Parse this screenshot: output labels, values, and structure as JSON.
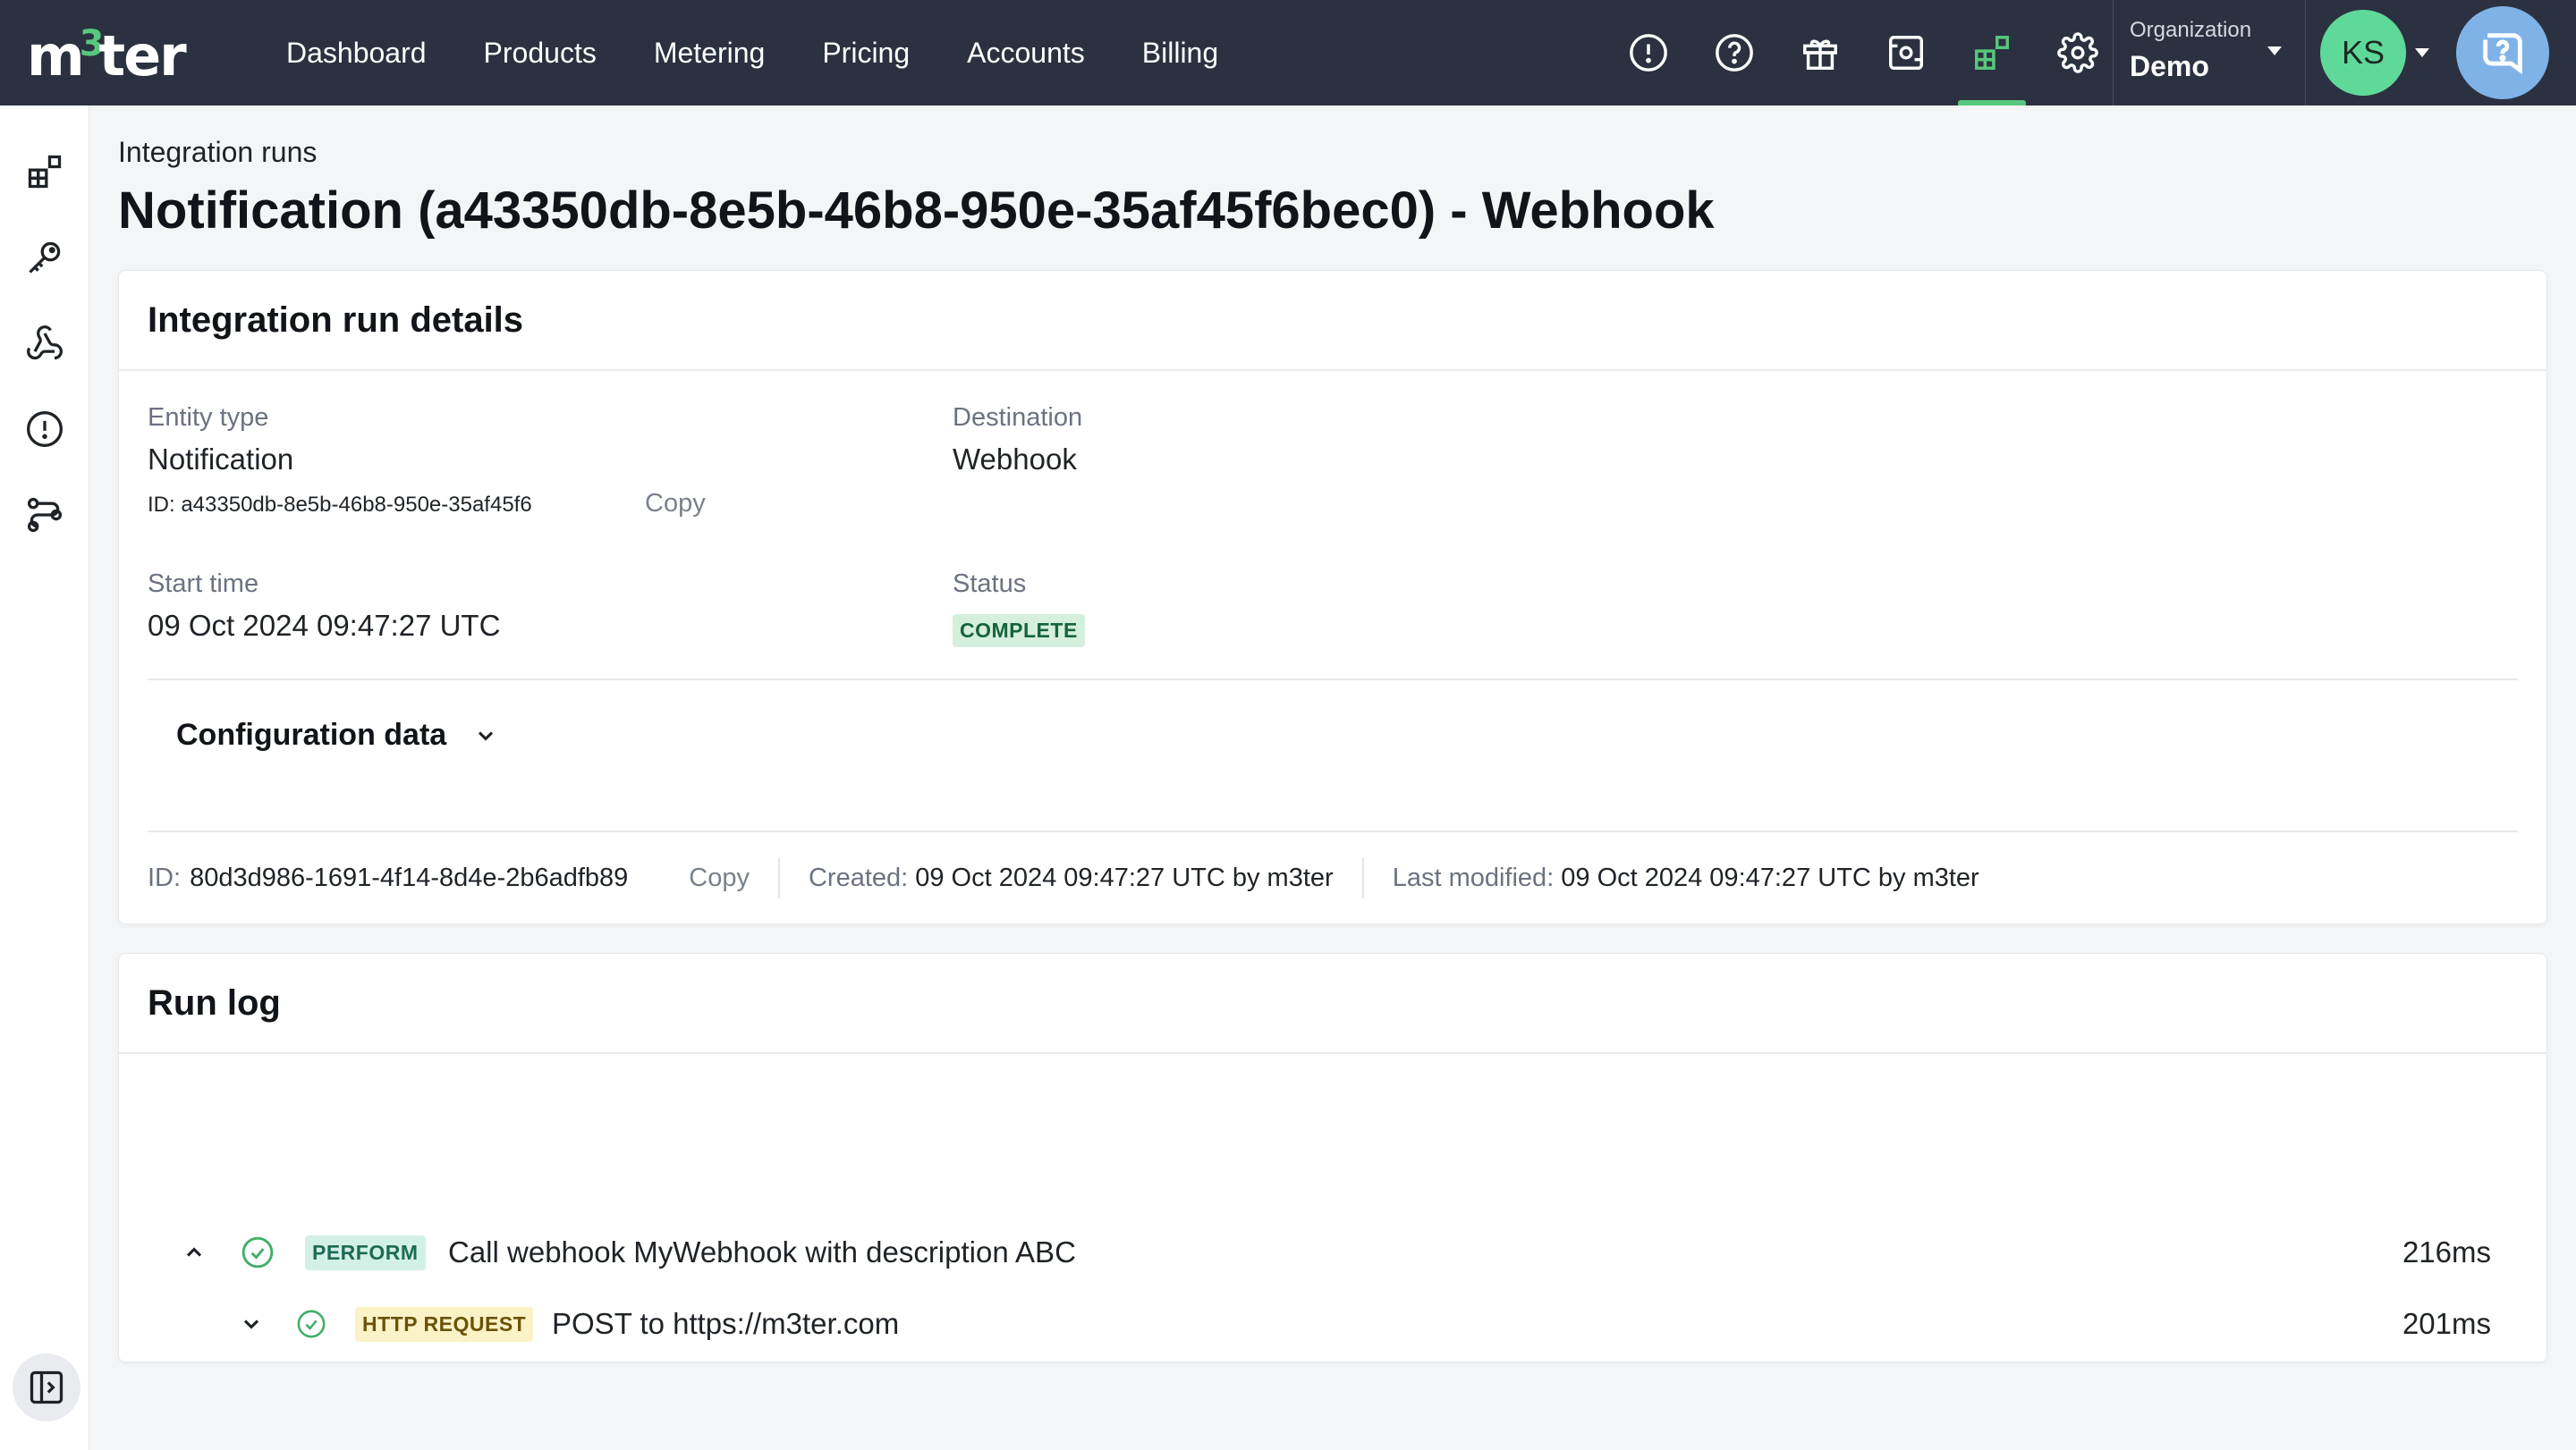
{
  "app": {
    "logo": {
      "prefix": "m",
      "accent": "3",
      "suffix": "ter"
    },
    "brand_color": "#57c77d"
  },
  "nav": {
    "items": [
      {
        "label": "Dashboard"
      },
      {
        "label": "Products"
      },
      {
        "label": "Metering"
      },
      {
        "label": "Pricing"
      },
      {
        "label": "Accounts"
      },
      {
        "label": "Billing"
      }
    ]
  },
  "toolbar": {
    "icons": [
      "alert-icon",
      "help-icon",
      "gift-icon",
      "settings-panel-icon",
      "integrations-icon",
      "gear-icon"
    ],
    "active": "integrations-icon"
  },
  "org": {
    "label": "Organization",
    "name": "Demo"
  },
  "user": {
    "initials": "KS"
  },
  "sidebar": {
    "icons": [
      "integrations-icon",
      "key-icon",
      "webhook-icon",
      "alert-icon",
      "workflow-icon"
    ],
    "toggle": "sidebar-expand-icon"
  },
  "page": {
    "breadcrumb": "Integration runs",
    "title": "Notification (a43350db-8e5b-46b8-950e-35af45f6bec0) - Webhook"
  },
  "details": {
    "title": "Integration run details",
    "entity_type_label": "Entity type",
    "entity_type_value": "Notification",
    "entity_id": "ID: a43350db-8e5b-46b8-950e-35af45f6",
    "copy_label": "Copy",
    "destination_label": "Destination",
    "destination_value": "Webhook",
    "start_time_label": "Start time",
    "start_time_value": "09 Oct 2024 09:47:27 UTC",
    "status_label": "Status",
    "status_value": "COMPLETE",
    "status_color": "#17643a",
    "config_label": "Configuration data",
    "meta": {
      "id_label": "ID:",
      "id_value": "80d3d986-1691-4f14-8d4e-2b6adfb89",
      "copy_label": "Copy",
      "created_label": "Created:",
      "created_value": "09 Oct 2024 09:47:27 UTC by m3ter",
      "modified_label": "Last modified:",
      "modified_value": "09 Oct 2024 09:47:27 UTC by m3ter"
    }
  },
  "run_log": {
    "title": "Run log",
    "entries": [
      {
        "tag": "PERFORM",
        "text": "Call webhook MyWebhook with description ABC",
        "duration": "216ms",
        "expanded": true
      },
      {
        "tag": "HTTP REQUEST",
        "text": "POST to https://m3ter.com",
        "duration": "201ms",
        "expanded": false
      }
    ]
  }
}
